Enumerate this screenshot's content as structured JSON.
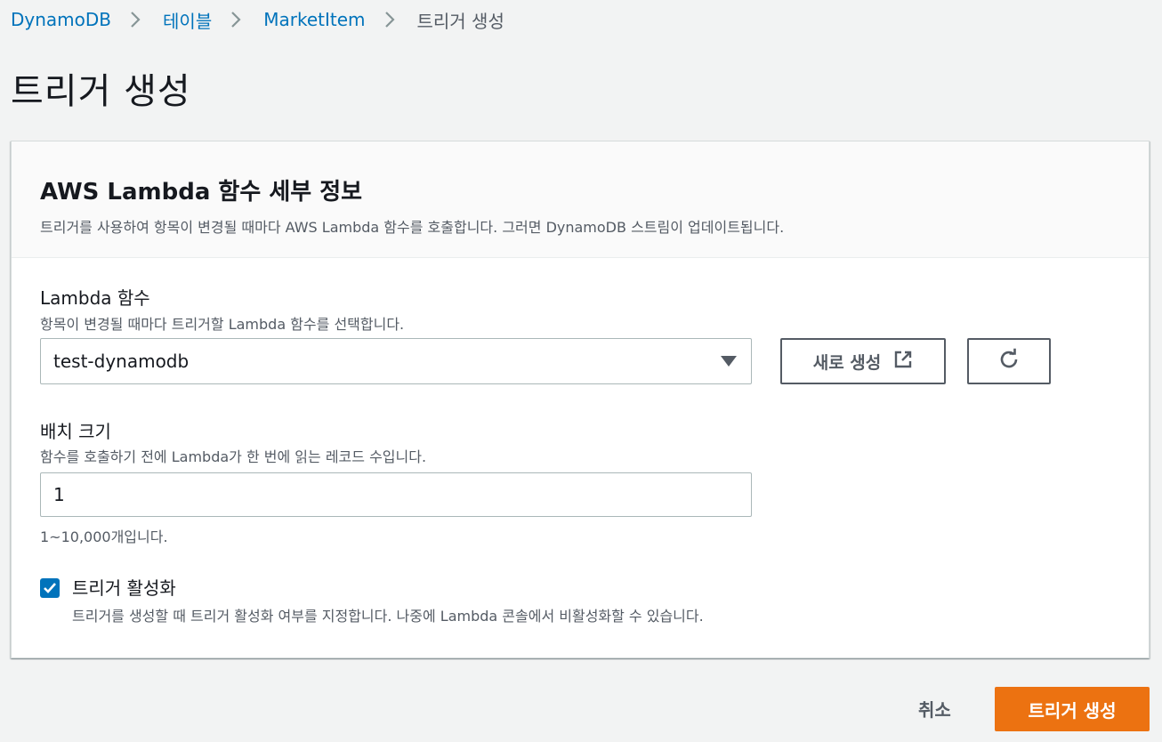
{
  "breadcrumb": {
    "items": [
      "DynamoDB",
      "테이블",
      "MarketItem"
    ],
    "current": "트리거 생성"
  },
  "page_title": "트리거 생성",
  "panel": {
    "title": "AWS Lambda 함수 세부 정보",
    "description": "트리거를 사용하여 항목이 변경될 때마다 AWS Lambda 함수를 호출합니다. 그러면 DynamoDB 스트림이 업데이트됩니다."
  },
  "lambda_field": {
    "label": "Lambda 함수",
    "description": "항목이 변경될 때마다 트리거할 Lambda 함수를 선택합니다.",
    "selected": "test-dynamodb",
    "new_button_label": "새로 생성",
    "new_button_icon": "external-link-icon",
    "refresh_icon": "refresh-icon"
  },
  "batch_field": {
    "label": "배치 크기",
    "description": "함수를 호출하기 전에 Lambda가 한 번에 읽는 레코드 수입니다.",
    "value": "1",
    "constraint": "1~10,000개입니다."
  },
  "enable_trigger": {
    "checked": true,
    "label": "트리거 활성화",
    "description": "트리거를 생성할 때 트리거 활성화 여부를 지정합니다. 나중에 Lambda 콘솔에서 비활성화할 수 있습니다."
  },
  "footer": {
    "cancel_label": "취소",
    "submit_label": "트리거 생성"
  },
  "colors": {
    "link": "#0073bb",
    "primary": "#ec7211",
    "checkbox": "#0073bb",
    "background": "#f2f3f3"
  }
}
